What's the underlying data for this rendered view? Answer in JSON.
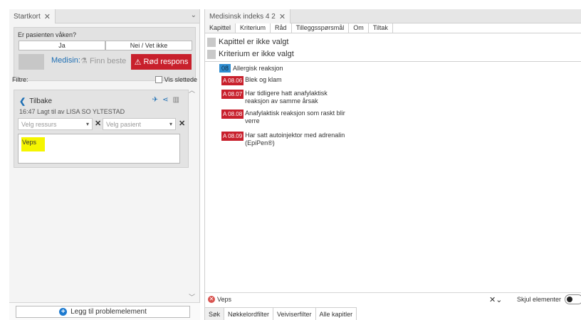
{
  "left": {
    "tab_title": "Startkort",
    "question": "Er pasienten våken?",
    "answer_yes": "Ja",
    "answer_no": "Nei / Vet ikke",
    "medisin_label": "Medisin:",
    "finn_label": "Finn beste",
    "red_button_label": "Rød respons",
    "filters_label": "Filtre:",
    "vis_slettede_label": "Vis slettede",
    "card": {
      "back_label": "Tilbake",
      "note": "16:47 Lagt til av LISA SO YLTESTAD",
      "ressurs_placeholder": "Velg ressurs",
      "pasient_placeholder": "Velg pasient",
      "text_value": "Veps"
    },
    "add_button_label": "Legg til problemelement"
  },
  "right": {
    "tab_title": "Medisinsk indeks 4 2",
    "tabs": [
      "Kapittel",
      "Kriterium",
      "Råd",
      "Tilleggsspørsmål",
      "Om",
      "Tiltak"
    ],
    "chapter_not_selected": "Kapittel er ikke valgt",
    "criterion_not_selected": "Kriterium er ikke valgt",
    "chapter": {
      "number": "08",
      "title": "Allergisk reaksjon"
    },
    "items": [
      {
        "code": "A 08.06",
        "text": "Blek og klam"
      },
      {
        "code": "A 08.07",
        "text": "Har tidligere hatt anafylaktisk reaksjon av samme årsak"
      },
      {
        "code": "A 08.08",
        "text": "Anafylaktisk reaksjon som raskt blir verre"
      },
      {
        "code": "A 08.09",
        "text": "Har satt autoinjektor med adrenalin (EpiPen®)"
      }
    ],
    "search_chip": "Veps",
    "skjul_label": "Skjul elementer",
    "bottom_tabs": [
      "Søk",
      "Nøkkelordfilter",
      "Veiviserfilter",
      "Alle kapitler"
    ]
  },
  "colors": {
    "accent_red": "#c8202c",
    "accent_blue": "#1e6fb4",
    "highlight": "#f5f500"
  },
  "icons": [
    "close-icon",
    "chevron-down-icon",
    "warning-icon",
    "pill-icon",
    "pin-icon",
    "share-icon",
    "trash-icon",
    "plus-circle-icon",
    "remove-icon"
  ]
}
